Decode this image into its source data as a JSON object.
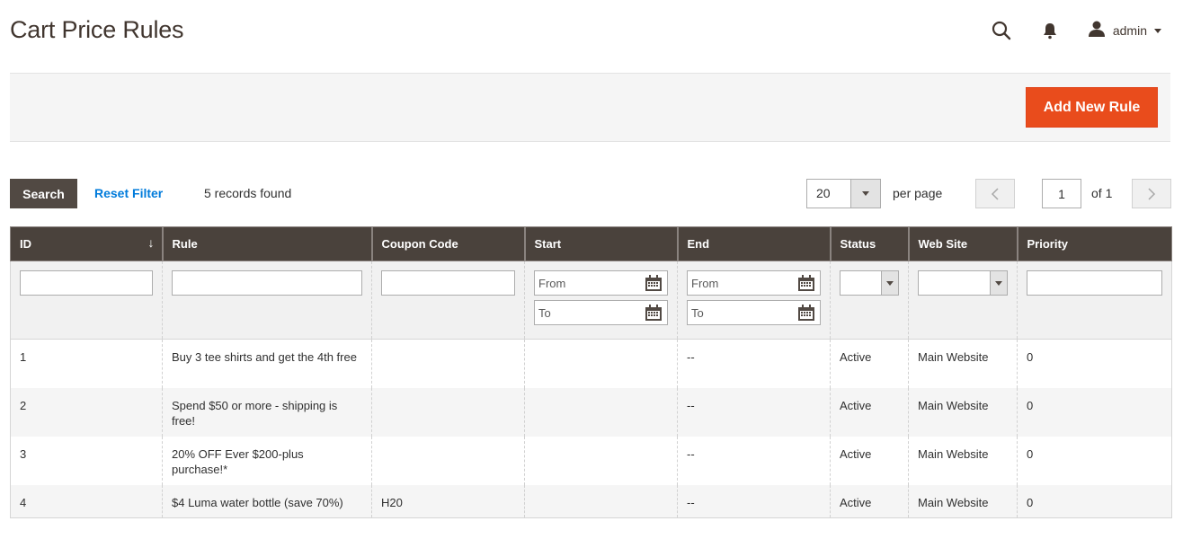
{
  "header": {
    "title": "Cart Price Rules",
    "user_name": "admin",
    "icons": {
      "search": "search-icon",
      "notifications": "bell-icon",
      "user": "user-icon"
    }
  },
  "actions": {
    "add_new_rule": "Add New Rule",
    "accent_color": "#e94c1c"
  },
  "toolbar": {
    "search_label": "Search",
    "reset_filter_label": "Reset Filter",
    "records_found": "5 records found",
    "per_page_value": "20",
    "per_page_label": "per page",
    "current_page": "1",
    "total_pages_label": "of 1"
  },
  "grid": {
    "columns": [
      {
        "label": "ID",
        "sorted": "desc"
      },
      {
        "label": "Rule"
      },
      {
        "label": "Coupon Code"
      },
      {
        "label": "Start"
      },
      {
        "label": "End"
      },
      {
        "label": "Status"
      },
      {
        "label": "Web Site"
      },
      {
        "label": "Priority"
      }
    ],
    "filters": {
      "id": "",
      "rule": "",
      "coupon_code": "",
      "start_from_placeholder": "From",
      "start_to_placeholder": "To",
      "end_from_placeholder": "From",
      "end_to_placeholder": "To",
      "status": "",
      "website": "",
      "priority": ""
    },
    "rows": [
      {
        "id": "1",
        "rule": "Buy 3 tee shirts and get the 4th free",
        "coupon": "",
        "start": "",
        "end": "--",
        "status": "Active",
        "website": "Main Website",
        "priority": "0"
      },
      {
        "id": "2",
        "rule": "Spend $50 or more - shipping is free!",
        "coupon": "",
        "start": "",
        "end": "--",
        "status": "Active",
        "website": "Main Website",
        "priority": "0"
      },
      {
        "id": "3",
        "rule": "20% OFF Ever $200-plus purchase!*",
        "coupon": "",
        "start": "",
        "end": "--",
        "status": "Active",
        "website": "Main Website",
        "priority": "0"
      },
      {
        "id": "4",
        "rule": "$4 Luma water bottle (save 70%)",
        "coupon": "H20",
        "start": "",
        "end": "--",
        "status": "Active",
        "website": "Main Website",
        "priority": "0"
      }
    ]
  }
}
